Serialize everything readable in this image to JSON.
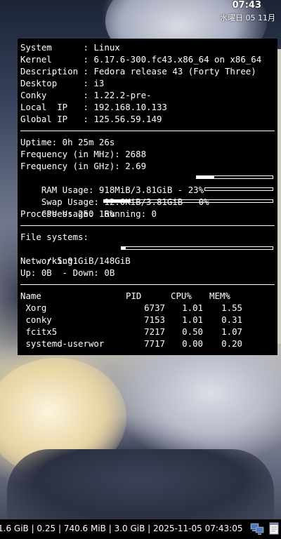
{
  "topbar": {
    "time": "07:43",
    "date": "水曜日 05 11月"
  },
  "conky": {
    "system": [
      {
        "key": "System     ",
        "value": "Linux"
      },
      {
        "key": "Kernel     ",
        "value": "6.17.6-300.fc43.x86_64 on x86_64"
      },
      {
        "key": "Description",
        "value": "Fedora release 43 (Forty Three)"
      },
      {
        "key": "Desktop    ",
        "value": "i3"
      },
      {
        "key": "Conky      ",
        "value": "1.22.2-pre-"
      },
      {
        "key": "Local  IP  ",
        "value": "192.168.10.133"
      },
      {
        "key": "Global IP  ",
        "value": "125.56.59.149"
      }
    ],
    "uptime": "Uptime: 0h 25m 26s",
    "freq_mhz": "Frequency (in MHz): 2688",
    "freq_ghz": "Frequency (in GHz): 2.69",
    "ram": {
      "label": "RAM Usage: 918MiB/3.81GiB - 23%",
      "percent": 23
    },
    "swap": {
      "label": "Swap Usage: 12.0KiB/3.81GiB - 0%",
      "percent": 0
    },
    "cpu": {
      "label": "CPU Usage: 16%",
      "percent": 16
    },
    "processes": "Processes: 250  Running: 0",
    "filesystems_title": "File systems:",
    "root_fs": {
      "label": " / 5.01GiB/148GiB",
      "percent": 3
    },
    "networking_title": "Networking:",
    "network": "Up: 0B  - Down: 0B",
    "process_table": {
      "headers": [
        "Name",
        "PID",
        "CPU%",
        "MEM%"
      ],
      "rows": [
        {
          "name": " Xorg",
          "pid": "6737",
          "cpu": "1.01",
          "mem": "1.55"
        },
        {
          "name": " conky",
          "pid": "7153",
          "cpu": "1.01",
          "mem": "0.31"
        },
        {
          "name": " fcitx5",
          "pid": "7217",
          "cpu": "0.50",
          "mem": "1.07"
        },
        {
          "name": " systemd-userwor",
          "pid": "7717",
          "cpu": "0.00",
          "mem": "0.20"
        }
      ]
    }
  },
  "bottombar": {
    "status": "1.6 GiB | 0.25 | 740.6 MiB | 3.0 GiB | 2025-11-05 07:43:05",
    "tray_icons": [
      "network-icon",
      "notes-icon"
    ]
  }
}
